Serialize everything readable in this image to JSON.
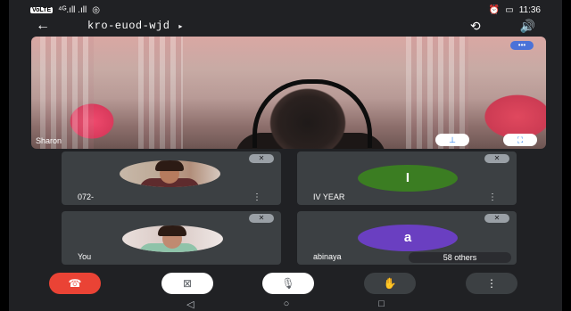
{
  "status_bar": {
    "carrier_chip": "VoLTE",
    "signal": "⁴ᴳ.ıll  .ıll",
    "time": "11:36",
    "battery": "▭"
  },
  "top_bar": {
    "meeting_code": "kro-euod-wjd",
    "caret": "▸"
  },
  "main_video": {
    "participant_name": "Sharon",
    "more_label": "•••"
  },
  "tiles": [
    {
      "name": "072-",
      "avatar_type": "photo"
    },
    {
      "name": "IV YEAR",
      "avatar_type": "letter",
      "letter": "I",
      "color": "#3b7d22"
    },
    {
      "name": "You",
      "avatar_type": "photo"
    },
    {
      "name": "abinaya",
      "avatar_type": "letter",
      "letter": "a",
      "color": "#6a3fc1",
      "others": "58 others"
    }
  ],
  "icons": {
    "back": "back-arrow-icon",
    "switch_camera": "switch-camera-icon",
    "speaker": "speaker-icon",
    "pin": "pin-icon",
    "fullscreen": "fullscreen-icon",
    "muted": "mic-off-icon",
    "end_call": "end-call-icon",
    "camera_off": "camera-off-icon",
    "mic_off": "mic-off-icon",
    "raise_hand": "raise-hand-icon",
    "more": "more-vert-icon"
  },
  "colors": {
    "end_call": "#ea4335",
    "accent": "#1a73e8",
    "tile_bg": "#3c4043"
  }
}
